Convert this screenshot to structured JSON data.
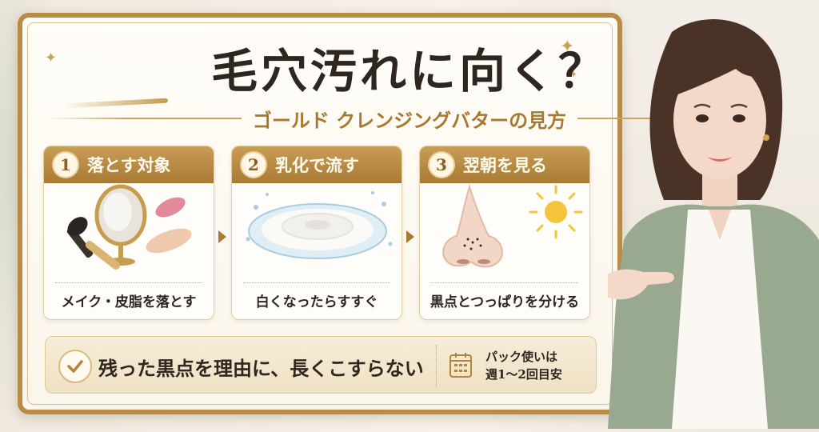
{
  "title": "毛穴汚れに向く？",
  "subtitle": "ゴールド クレンジングバターの見方",
  "steps": [
    {
      "number": "1",
      "label": "落とす対象",
      "caption": "メイク・皮脂を落とす",
      "icon": "makeup-tools-icon"
    },
    {
      "number": "2",
      "label": "乳化で流す",
      "caption": "白くなったらすすぐ",
      "icon": "milky-splash-icon"
    },
    {
      "number": "3",
      "label": "翌朝を見る",
      "caption": "黒点とつっぱりを分ける",
      "icon": "nose-sun-icon"
    }
  ],
  "bottom": {
    "main": "残った黒点を理由に、長くこすらない",
    "note_line1": "パック使いは",
    "note_line2": "週1～2回目安"
  },
  "colors": {
    "gold": "#b98b45",
    "gold_dark": "#a87a34",
    "text": "#2f2620",
    "accent": "#a8782e"
  }
}
